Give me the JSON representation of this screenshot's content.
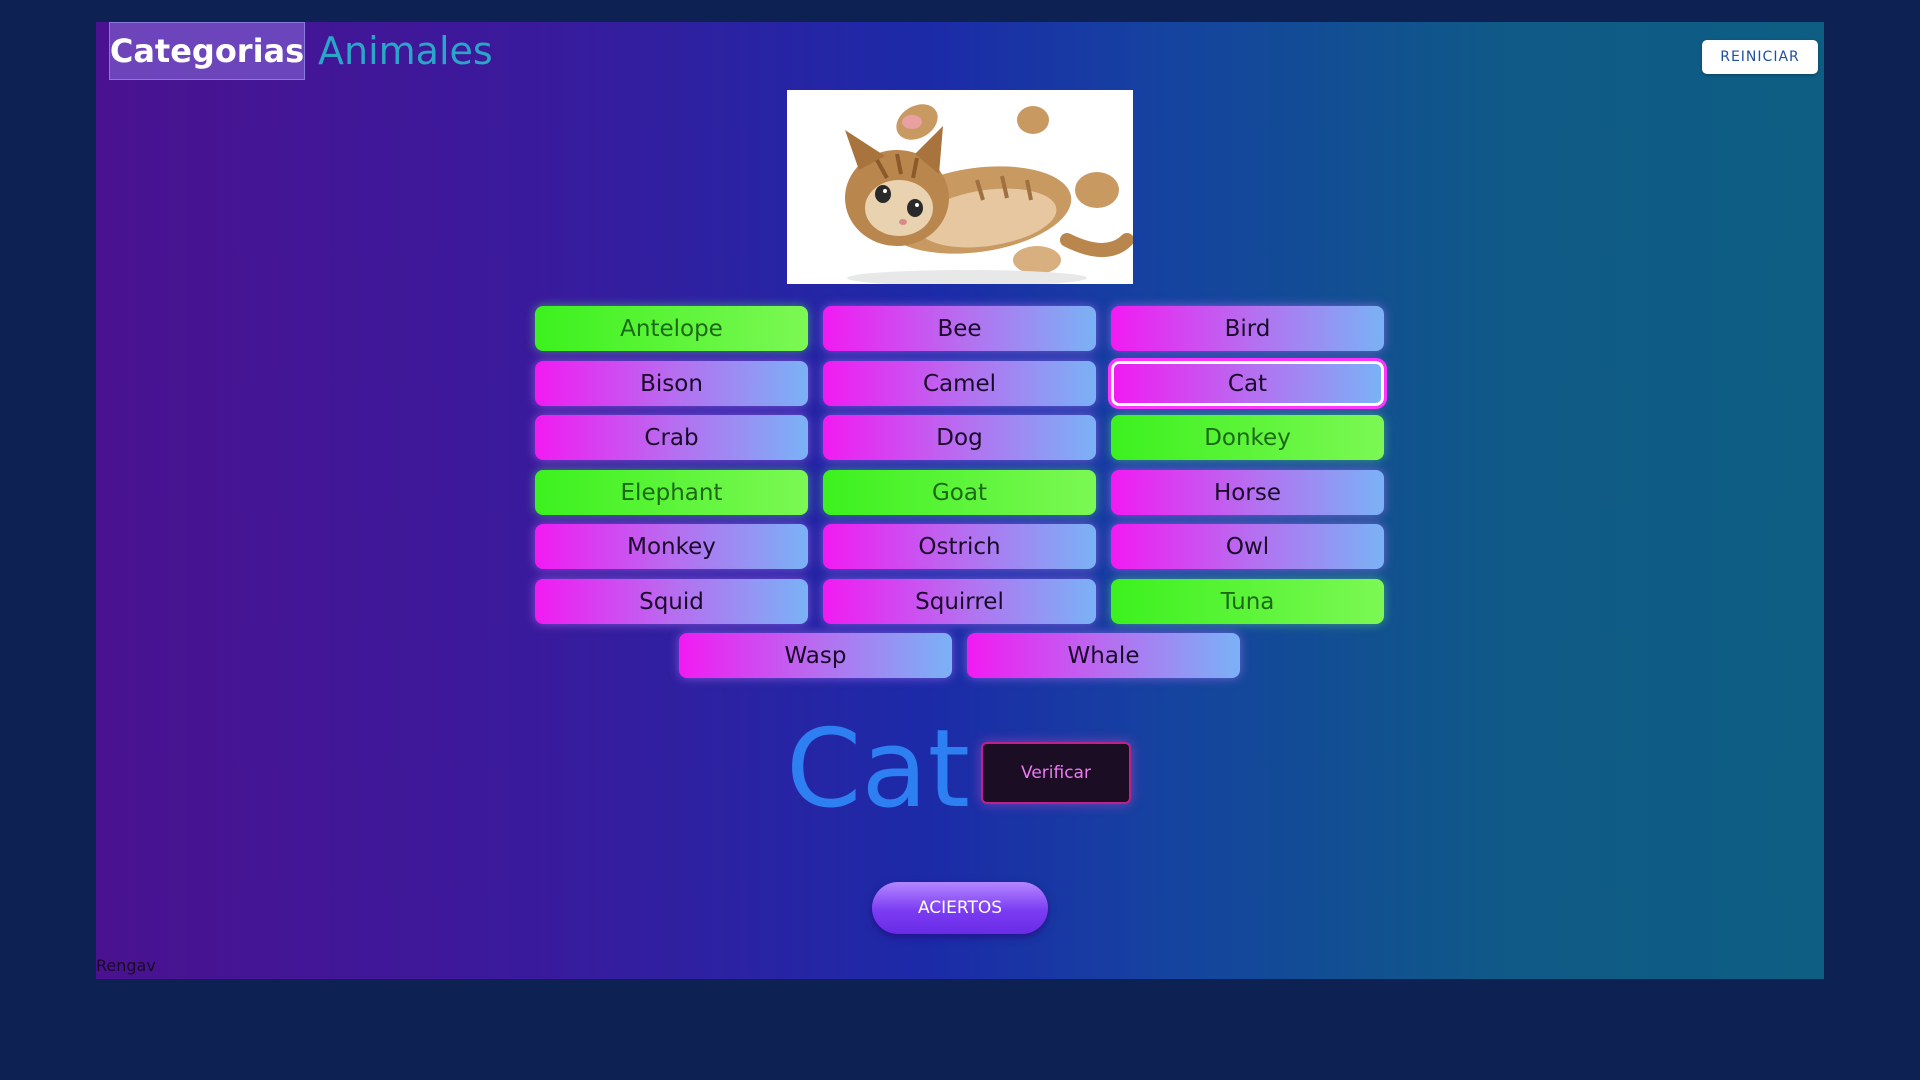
{
  "header": {
    "category_tab": "Categorias",
    "current_category": "Animales",
    "reset_label": "REINICIAR"
  },
  "picture": {
    "subject": "kitten",
    "alt": "cat-photo"
  },
  "options": [
    {
      "label": "Antelope",
      "style": "green"
    },
    {
      "label": "Bee",
      "style": "pink"
    },
    {
      "label": "Bird",
      "style": "pink"
    },
    {
      "label": "Bison",
      "style": "pink"
    },
    {
      "label": "Camel",
      "style": "pink"
    },
    {
      "label": "Cat",
      "style": "pink",
      "selected": true
    },
    {
      "label": "Crab",
      "style": "pink"
    },
    {
      "label": "Dog",
      "style": "pink"
    },
    {
      "label": "Donkey",
      "style": "green"
    },
    {
      "label": "Elephant",
      "style": "green"
    },
    {
      "label": "Goat",
      "style": "green"
    },
    {
      "label": "Horse",
      "style": "pink"
    },
    {
      "label": "Monkey",
      "style": "pink"
    },
    {
      "label": "Ostrich",
      "style": "pink"
    },
    {
      "label": "Owl",
      "style": "pink"
    },
    {
      "label": "Squid",
      "style": "pink"
    },
    {
      "label": "Squirrel",
      "style": "pink"
    },
    {
      "label": "Tuna",
      "style": "green"
    },
    {
      "label": "Wasp",
      "style": "pink"
    },
    {
      "label": "Whale",
      "style": "pink"
    }
  ],
  "answer": {
    "current_word": "Cat",
    "verify_label": "Verificar"
  },
  "score": {
    "aciertos_label": "ACIERTOS"
  },
  "footer": {
    "credit": "Rengav"
  },
  "colors": {
    "option_pink_start": "#f21af2",
    "option_pink_end": "#7ab2f6",
    "option_green": "#3cf11e",
    "word_color": "#2e7ff2",
    "page_bg": "#0d2152"
  }
}
